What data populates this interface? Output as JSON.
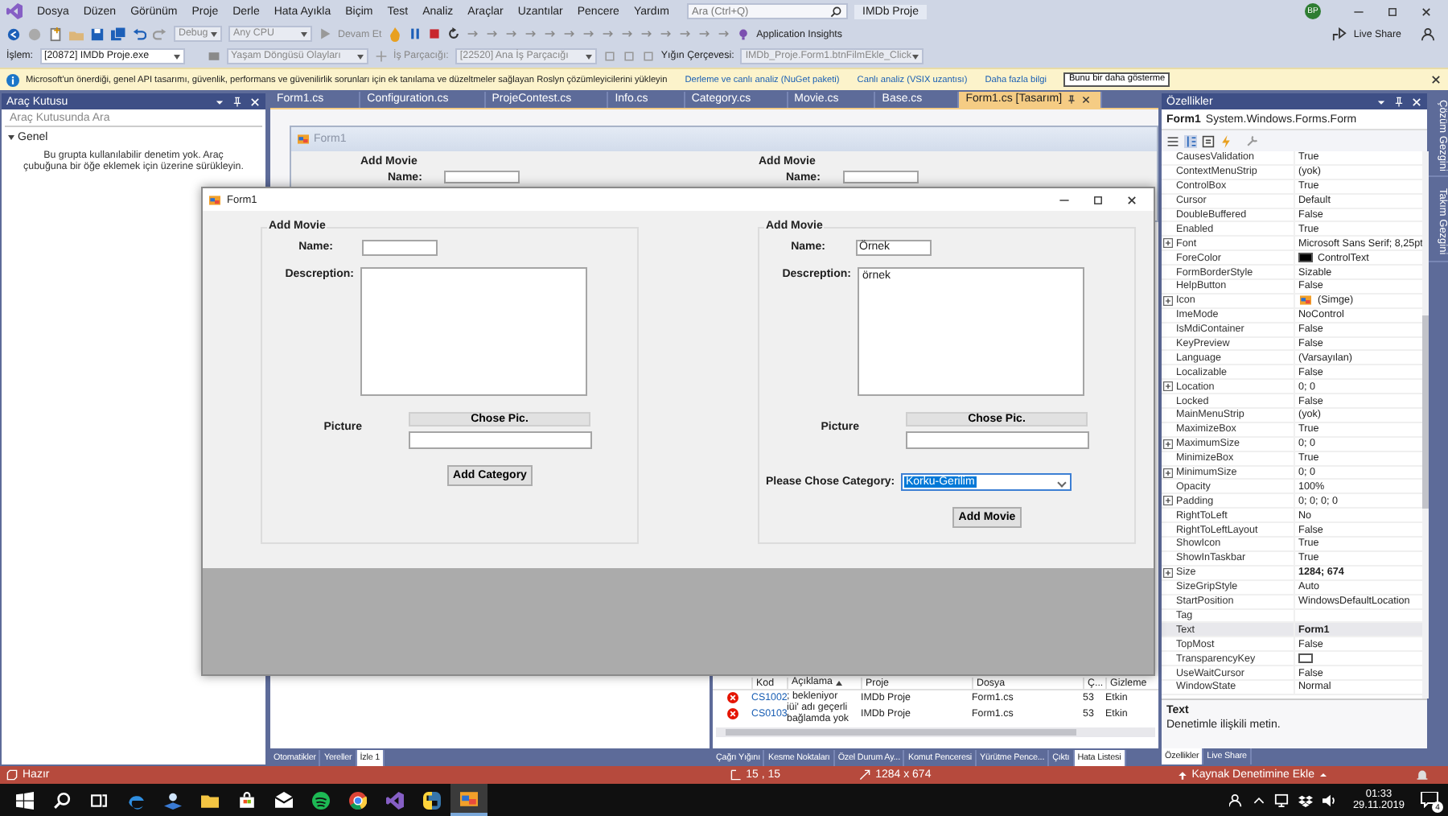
{
  "menu": [
    "Dosya",
    "Düzen",
    "Görünüm",
    "Proje",
    "Derle",
    "Hata Ayıkla",
    "Biçim",
    "Test",
    "Analiz",
    "Araçlar",
    "Uzantılar",
    "Pencere",
    "Yardım"
  ],
  "search": {
    "placeholder": "Ara (Ctrl+Q)"
  },
  "solution_name": "IMDb Proje",
  "avatar": "BP",
  "toolbar": {
    "configuration": "Debug",
    "platform": "Any CPU",
    "continue": "Devam Et",
    "insights": "Application Insights",
    "live_share": "Live Share"
  },
  "debug_bar": {
    "process_label": "İşlem:",
    "process": "[20872] IMDb Proje.exe",
    "lifecycle": "Yaşam Döngüsü Olayları",
    "thread_label": "İş Parçacığı:",
    "thread": "[22520] Ana İş Parçacığı",
    "stack_label": "Yığın Çerçevesi:",
    "stack_frame": "IMDb_Proje.Form1.btnFilmEkle_Click"
  },
  "infobar": {
    "message": "Microsoft'un önerdiği, genel API tasarımı, güvenlik, performans ve güvenilirlik sorunları için ek tanılama ve düzeltmeler sağlayan Roslyn çözümleyicilerini yükleyin",
    "links": [
      "Derleme ve canlı analiz (NuGet paketi)",
      "Canlı analiz (VSIX uzantısı)",
      "Daha fazla bilgi"
    ],
    "dismiss": "Bunu bir daha gösterme"
  },
  "toolbox": {
    "title": "Araç Kutusu",
    "search_placeholder": "Araç Kutusunda Ara",
    "group": "Genel",
    "expanded": true,
    "empty_message": "Bu grupta kullanılabilir denetim yok. Araç çubuğuna bir öğe eklemek için üzerine sürükleyin."
  },
  "document_tabs": [
    {
      "label": "Form1.cs",
      "selected": false
    },
    {
      "label": "Configuration.cs",
      "selected": false
    },
    {
      "label": "ProjeContest.cs",
      "selected": false
    },
    {
      "label": "Info.cs",
      "selected": false
    },
    {
      "label": "Category.cs",
      "selected": false
    },
    {
      "label": "Movie.cs",
      "selected": false
    },
    {
      "label": "Base.cs",
      "selected": false
    },
    {
      "label": "Form1.cs [Tasarım]",
      "selected": true
    }
  ],
  "designer_form": {
    "title": "Form1",
    "groups": [
      {
        "title": "Add Movie",
        "name_label": "Name:"
      },
      {
        "title": "Add Movie",
        "name_label": "Name:"
      }
    ]
  },
  "running_form": {
    "title": "Form1",
    "groups": [
      {
        "title": "Add Movie",
        "name_label": "Name:",
        "description_label": "Descreption:",
        "picture_label": "Picture",
        "picture_button": "Chose Pic.",
        "action": "Add Category"
      },
      {
        "title": "Add Movie",
        "name_label": "Name:",
        "name_value": "Örnek",
        "description_label": "Descreption:",
        "description_value": "örnek",
        "picture_label": "Picture",
        "picture_button": "Chose Pic.",
        "category_label": "Please Chose Category:",
        "category_value": "Korku-Gerilim",
        "action": "Add Movie"
      }
    ]
  },
  "watch_panel": {
    "tabs": [
      {
        "label": "Otomatikler",
        "selected": false
      },
      {
        "label": "Yereller",
        "selected": false
      },
      {
        "label": "İzle 1",
        "selected": true
      }
    ]
  },
  "error_list": {
    "columns": [
      "Kod",
      "Açıklama",
      "Proje",
      "Dosya",
      "Ç...",
      "Gizleme"
    ],
    "rows": [
      {
        "code": "CS1002",
        "description": "; bekleniyor",
        "project": "IMDb Proje",
        "file": "Form1.cs",
        "line": "53",
        "suppression": "Etkin"
      },
      {
        "code": "CS0103",
        "description": "iüi' adı geçerli bağlamda yok",
        "project": "IMDb Proje",
        "file": "Form1.cs",
        "line": "53",
        "suppression": "Etkin"
      }
    ],
    "tabs": [
      {
        "label": "Çağrı Yığını",
        "selected": false
      },
      {
        "label": "Kesme Noktaları",
        "selected": false
      },
      {
        "label": "Özel Durum Ay...",
        "selected": false
      },
      {
        "label": "Komut Penceresi",
        "selected": false
      },
      {
        "label": "Yürütme Pence...",
        "selected": false
      },
      {
        "label": "Çıktı",
        "selected": false
      },
      {
        "label": "Hata Listesi",
        "selected": true
      }
    ]
  },
  "properties": {
    "title": "Özellikler",
    "object_name": "Form1",
    "object_type": "System.Windows.Forms.Form",
    "rows": [
      {
        "name": "CausesValidation",
        "value": "True",
        "kind": "text",
        "expandable": false,
        "modified": false,
        "selected": false
      },
      {
        "name": "ContextMenuStrip",
        "value": "(yok)",
        "kind": "text",
        "expandable": false,
        "modified": false,
        "selected": false
      },
      {
        "name": "ControlBox",
        "value": "True",
        "kind": "text",
        "expandable": false,
        "modified": false,
        "selected": false
      },
      {
        "name": "Cursor",
        "value": "Default",
        "kind": "text",
        "expandable": false,
        "modified": false,
        "selected": false
      },
      {
        "name": "DoubleBuffered",
        "value": "False",
        "kind": "text",
        "expandable": false,
        "modified": false,
        "selected": false
      },
      {
        "name": "Enabled",
        "value": "True",
        "kind": "text",
        "expandable": false,
        "modified": false,
        "selected": false
      },
      {
        "name": "Font",
        "value": "Microsoft Sans Serif; 8,25pt",
        "kind": "text",
        "expandable": true,
        "modified": false,
        "selected": false
      },
      {
        "name": "ForeColor",
        "value": "ControlText",
        "kind": "color",
        "color": "#000000",
        "expandable": false,
        "modified": false,
        "selected": false
      },
      {
        "name": "FormBorderStyle",
        "value": "Sizable",
        "kind": "text",
        "expandable": false,
        "modified": false,
        "selected": false
      },
      {
        "name": "HelpButton",
        "value": "False",
        "kind": "text",
        "expandable": false,
        "modified": false,
        "selected": false
      },
      {
        "name": "Icon",
        "value": "(Simge)",
        "kind": "icon",
        "expandable": true,
        "modified": false,
        "selected": false
      },
      {
        "name": "ImeMode",
        "value": "NoControl",
        "kind": "text",
        "expandable": false,
        "modified": false,
        "selected": false
      },
      {
        "name": "IsMdiContainer",
        "value": "False",
        "kind": "text",
        "expandable": false,
        "modified": false,
        "selected": false
      },
      {
        "name": "KeyPreview",
        "value": "False",
        "kind": "text",
        "expandable": false,
        "modified": false,
        "selected": false
      },
      {
        "name": "Language",
        "value": "(Varsayılan)",
        "kind": "text",
        "expandable": false,
        "modified": false,
        "selected": false
      },
      {
        "name": "Localizable",
        "value": "False",
        "kind": "text",
        "expandable": false,
        "modified": false,
        "selected": false
      },
      {
        "name": "Location",
        "value": "0; 0",
        "kind": "text",
        "expandable": true,
        "modified": false,
        "selected": false
      },
      {
        "name": "Locked",
        "value": "False",
        "kind": "text",
        "expandable": false,
        "modified": false,
        "selected": false
      },
      {
        "name": "MainMenuStrip",
        "value": "(yok)",
        "kind": "text",
        "expandable": false,
        "modified": false,
        "selected": false
      },
      {
        "name": "MaximizeBox",
        "value": "True",
        "kind": "text",
        "expandable": false,
        "modified": false,
        "selected": false
      },
      {
        "name": "MaximumSize",
        "value": "0; 0",
        "kind": "text",
        "expandable": true,
        "modified": false,
        "selected": false
      },
      {
        "name": "MinimizeBox",
        "value": "True",
        "kind": "text",
        "expandable": false,
        "modified": false,
        "selected": false
      },
      {
        "name": "MinimumSize",
        "value": "0; 0",
        "kind": "text",
        "expandable": true,
        "modified": false,
        "selected": false
      },
      {
        "name": "Opacity",
        "value": "100%",
        "kind": "text",
        "expandable": false,
        "modified": false,
        "selected": false
      },
      {
        "name": "Padding",
        "value": "0; 0; 0; 0",
        "kind": "text",
        "expandable": true,
        "modified": false,
        "selected": false
      },
      {
        "name": "RightToLeft",
        "value": "No",
        "kind": "text",
        "expandable": false,
        "modified": false,
        "selected": false
      },
      {
        "name": "RightToLeftLayout",
        "value": "False",
        "kind": "text",
        "expandable": false,
        "modified": false,
        "selected": false
      },
      {
        "name": "ShowIcon",
        "value": "True",
        "kind": "text",
        "expandable": false,
        "modified": false,
        "selected": false
      },
      {
        "name": "ShowInTaskbar",
        "value": "True",
        "kind": "text",
        "expandable": false,
        "modified": false,
        "selected": false
      },
      {
        "name": "Size",
        "value": "1284; 674",
        "kind": "text",
        "expandable": true,
        "modified": true,
        "selected": false
      },
      {
        "name": "SizeGripStyle",
        "value": "Auto",
        "kind": "text",
        "expandable": false,
        "modified": false,
        "selected": false
      },
      {
        "name": "StartPosition",
        "value": "WindowsDefaultLocation",
        "kind": "text",
        "expandable": false,
        "modified": false,
        "selected": false
      },
      {
        "name": "Tag",
        "kind": "text",
        "expandable": false,
        "selected": false
      },
      {
        "name": "Text",
        "value": "Form1",
        "kind": "text",
        "expandable": false,
        "modified": true,
        "selected": true
      },
      {
        "name": "TopMost",
        "value": "False",
        "kind": "text",
        "expandable": false,
        "modified": false,
        "selected": false
      },
      {
        "name": "TransparencyKey",
        "kind": "color",
        "color": "#ffffff",
        "expandable": false,
        "selected": false
      },
      {
        "name": "UseWaitCursor",
        "value": "False",
        "kind": "text",
        "expandable": false,
        "modified": false,
        "selected": false
      },
      {
        "name": "WindowState",
        "value": "Normal",
        "kind": "text",
        "expandable": false,
        "modified": false,
        "selected": false
      }
    ],
    "help_title": "Text",
    "help_text": "Denetimle ilişkili metin.",
    "tabs": [
      {
        "label": "Özellikler",
        "selected": true
      },
      {
        "label": "Live Share",
        "selected": false
      }
    ]
  },
  "side_tabs": [
    "Çözüm Gezgini",
    "Takım Gezgini"
  ],
  "status_bar": {
    "state": "Hazır",
    "position": "15 , 15",
    "size": "1284 x 674",
    "source_control": "Kaynak Denetimine Ekle"
  },
  "taskbar": {
    "apps": [
      {
        "kind": "edge",
        "selected": false
      },
      {
        "kind": "people",
        "selected": false
      },
      {
        "kind": "folder",
        "selected": false
      },
      {
        "kind": "store",
        "selected": false
      },
      {
        "kind": "mail",
        "selected": false
      },
      {
        "kind": "spotify",
        "selected": false
      },
      {
        "kind": "chrome",
        "selected": false
      },
      {
        "kind": "vs",
        "selected": false
      },
      {
        "kind": "python",
        "selected": false
      },
      {
        "kind": "winform",
        "selected": true
      }
    ],
    "time": "01:33",
    "date": "29.11.2019",
    "notifications": "4"
  }
}
